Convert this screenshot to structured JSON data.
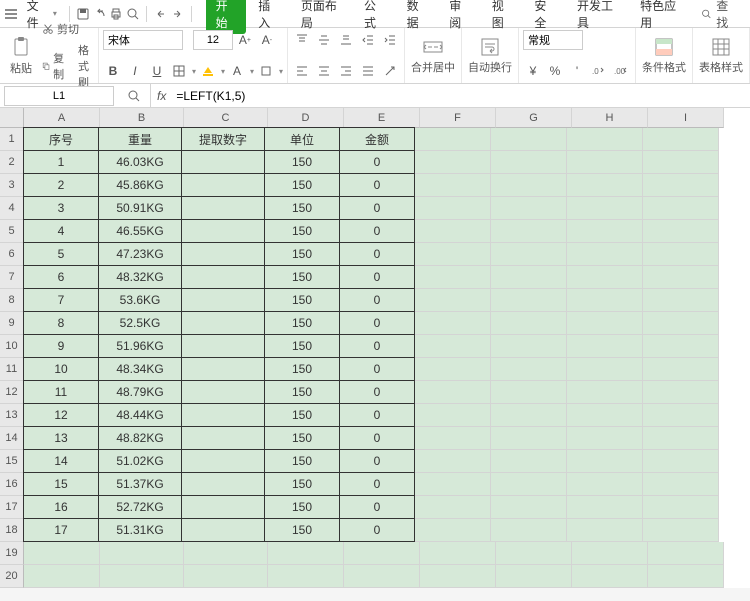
{
  "menubar": {
    "file": "文件",
    "tabs": [
      "开始",
      "插入",
      "页面布局",
      "公式",
      "数据",
      "审阅",
      "视图",
      "安全",
      "开发工具",
      "特色应用"
    ],
    "active_tab": 0,
    "search": "查找"
  },
  "ribbon": {
    "paste": "粘贴",
    "cut": "剪切",
    "copy": "复制",
    "format_painter": "格式刷",
    "font_name": "宋体",
    "font_size": "12",
    "merge": "合并居中",
    "wrap": "自动换行",
    "number_format": "常规",
    "cond_format": "条件格式",
    "table_style": "表格样式"
  },
  "formula_bar": {
    "cell_ref": "L1",
    "formula": "=LEFT(K1,5)"
  },
  "columns": [
    "A",
    "B",
    "C",
    "D",
    "E",
    "F",
    "G",
    "H",
    "I"
  ],
  "col_widths": [
    "c1",
    "c2",
    "c3",
    "c4",
    "c5",
    "c6",
    "c7",
    "c8",
    "c9"
  ],
  "row_count": 20,
  "chart_data": {
    "type": "table",
    "headers": [
      "序号",
      "重量",
      "提取数字",
      "单位",
      "金额"
    ],
    "rows": [
      [
        "1",
        "46.03KG",
        "",
        "150",
        "0"
      ],
      [
        "2",
        "45.86KG",
        "",
        "150",
        "0"
      ],
      [
        "3",
        "50.91KG",
        "",
        "150",
        "0"
      ],
      [
        "4",
        "46.55KG",
        "",
        "150",
        "0"
      ],
      [
        "5",
        "47.23KG",
        "",
        "150",
        "0"
      ],
      [
        "6",
        "48.32KG",
        "",
        "150",
        "0"
      ],
      [
        "7",
        "53.6KG",
        "",
        "150",
        "0"
      ],
      [
        "8",
        "52.5KG",
        "",
        "150",
        "0"
      ],
      [
        "9",
        "51.96KG",
        "",
        "150",
        "0"
      ],
      [
        "10",
        "48.34KG",
        "",
        "150",
        "0"
      ],
      [
        "11",
        "48.79KG",
        "",
        "150",
        "0"
      ],
      [
        "12",
        "48.44KG",
        "",
        "150",
        "0"
      ],
      [
        "13",
        "48.82KG",
        "",
        "150",
        "0"
      ],
      [
        "14",
        "51.02KG",
        "",
        "150",
        "0"
      ],
      [
        "15",
        "51.37KG",
        "",
        "150",
        "0"
      ],
      [
        "16",
        "52.72KG",
        "",
        "150",
        "0"
      ],
      [
        "17",
        "51.31KG",
        "",
        "150",
        "0"
      ]
    ]
  }
}
